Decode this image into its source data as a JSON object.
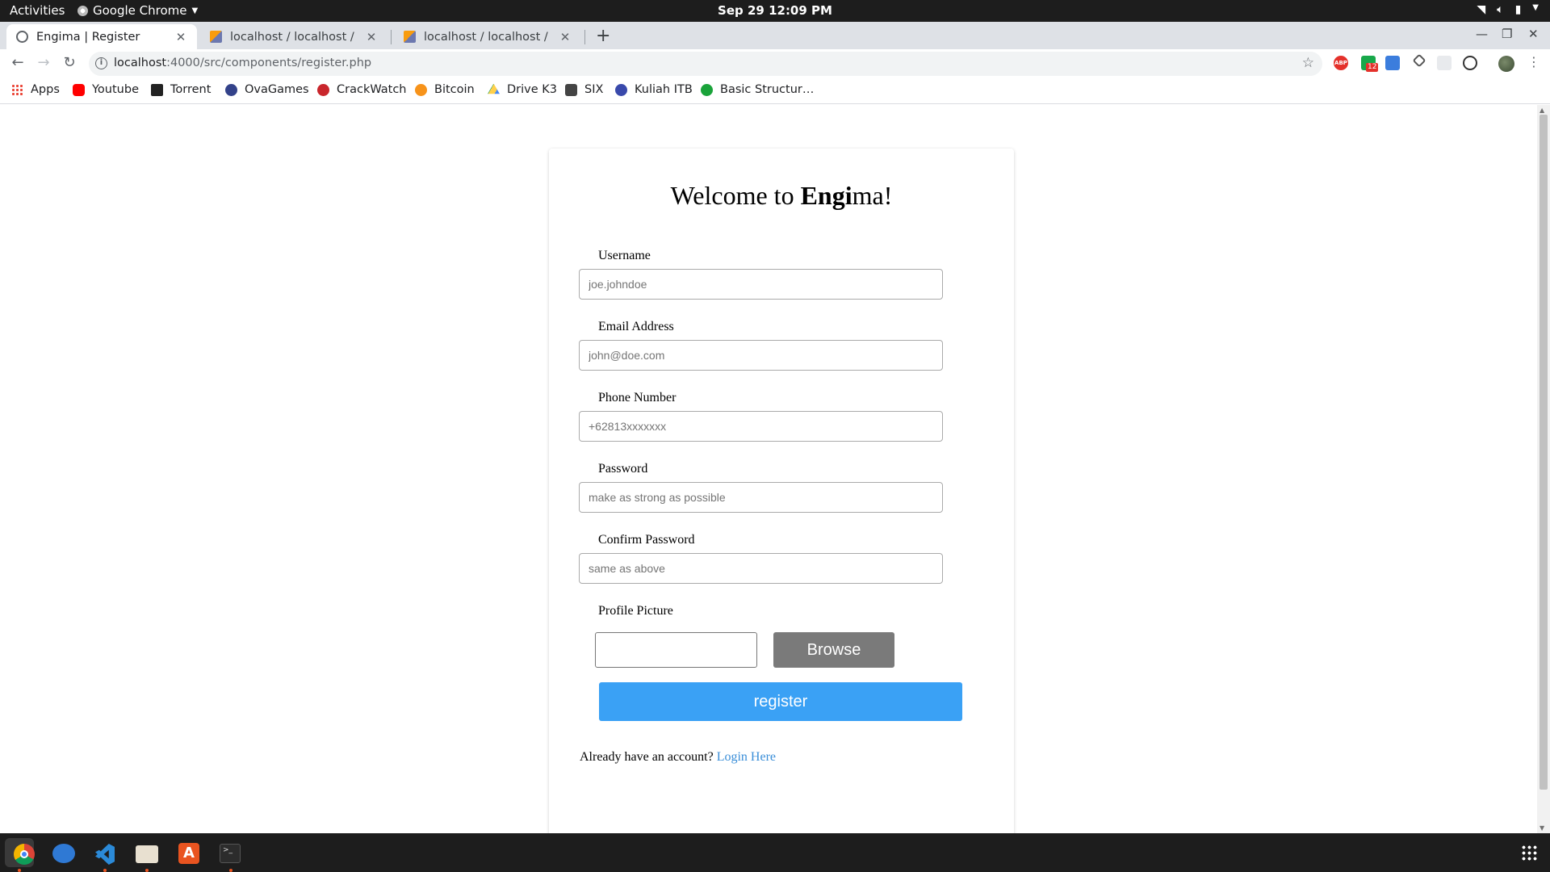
{
  "topbar": {
    "activities": "Activities",
    "app_name": "Google Chrome",
    "clock": "Sep 29  12:09 PM"
  },
  "tabs": [
    {
      "title": "Engima | Register",
      "active": true,
      "icon": "globe-icon"
    },
    {
      "title": "localhost / localhost / engima",
      "active": false,
      "icon": "phpmyadmin-icon"
    },
    {
      "title": "localhost / localhost / engima",
      "active": false,
      "icon": "phpmyadmin-icon"
    }
  ],
  "address_bar": {
    "host": "localhost",
    "path": ":4000/src/components/register.php"
  },
  "extensions": {
    "badge_count": "12",
    "abp_label": "ABP"
  },
  "bookmarks": [
    {
      "label": "Apps",
      "icon": "apps-grid-icon"
    },
    {
      "label": "Youtube",
      "icon": "youtube-icon"
    },
    {
      "label": "Torrent",
      "icon": "torrent-icon"
    },
    {
      "label": "OvaGames",
      "icon": "ovagames-icon"
    },
    {
      "label": "CrackWatch",
      "icon": "crackwatch-icon"
    },
    {
      "label": "Bitcoin",
      "icon": "bitcoin-icon"
    },
    {
      "label": "Drive K3",
      "icon": "google-drive-icon"
    },
    {
      "label": "SIX",
      "icon": "six-icon"
    },
    {
      "label": "Kuliah ITB",
      "icon": "itb-icon"
    },
    {
      "label": "Basic Structur…",
      "icon": "basic-structure-icon"
    }
  ],
  "page": {
    "welcome_prefix": "Welcome to ",
    "welcome_bold": "Engi",
    "welcome_suffix": "ma!",
    "fields": {
      "username": {
        "label": "Username",
        "placeholder": "joe.johndoe"
      },
      "email": {
        "label": "Email Address",
        "placeholder": "john@doe.com"
      },
      "phone": {
        "label": "Phone Number",
        "placeholder": "+62813xxxxxxx"
      },
      "password": {
        "label": "Password",
        "placeholder": "make as strong as possible"
      },
      "confirm": {
        "label": "Confirm Password",
        "placeholder": "same as above"
      },
      "picture": {
        "label": "Profile Picture"
      }
    },
    "browse_label": "Browse",
    "register_label": "register",
    "login_prompt": "Already have an account?",
    "login_link": "Login Here"
  },
  "colors": {
    "register_button": "#3aa1f5",
    "browse_button": "#7a7a7a",
    "login_link": "#3a8ed8",
    "topbar": "#1d1d1d"
  }
}
